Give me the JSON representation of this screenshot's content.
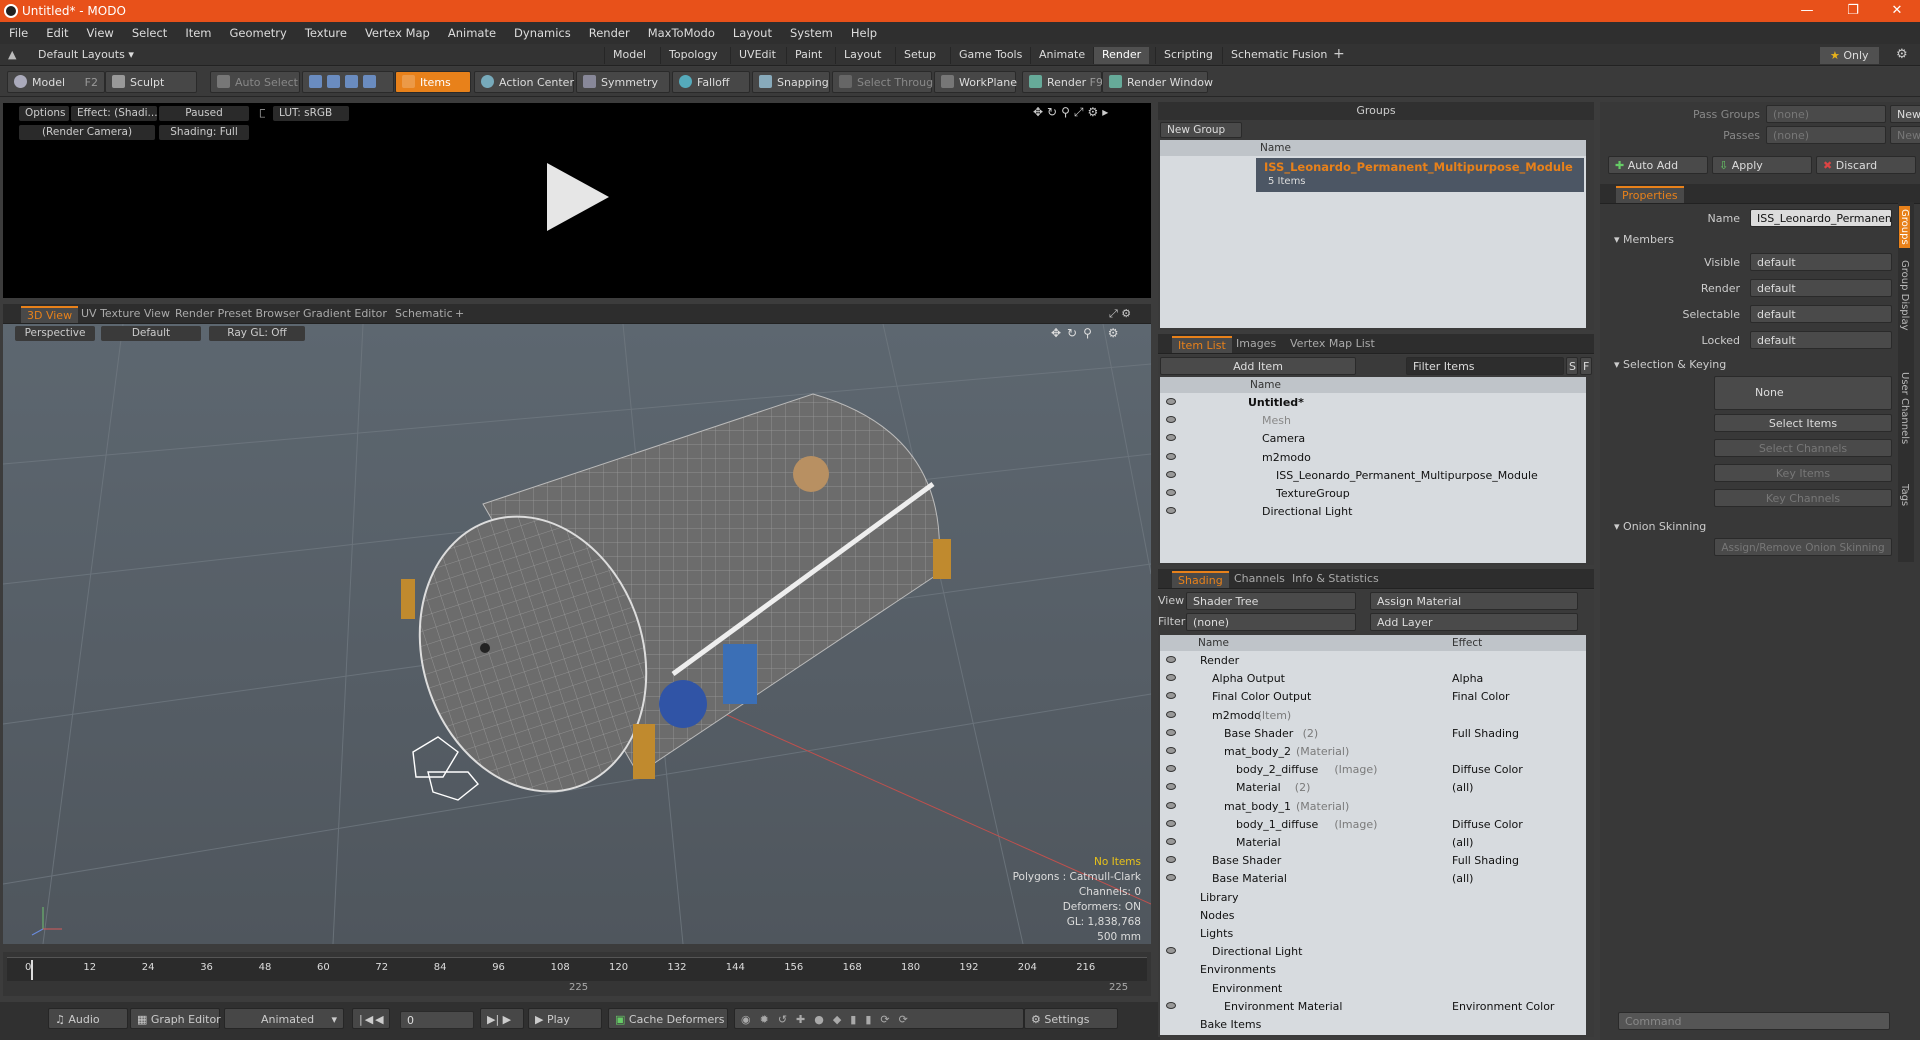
{
  "window": {
    "title": "Untitled* - MODO"
  },
  "menu": [
    "File",
    "Edit",
    "View",
    "Select",
    "Item",
    "Geometry",
    "Texture",
    "Vertex Map",
    "Animate",
    "Dynamics",
    "Render",
    "MaxToModo",
    "Layout",
    "System",
    "Help"
  ],
  "layoutbar": {
    "preset": "Default Layouts",
    "tabs": [
      "Model",
      "Topology",
      "UVEdit",
      "Paint",
      "Layout",
      "Setup",
      "Game Tools",
      "Animate",
      "Render",
      "Scripting",
      "Schematic Fusion"
    ],
    "active": "Render",
    "only": "Only"
  },
  "toolbar": {
    "model": "Model",
    "model_key": "F2",
    "sculpt": "Sculpt",
    "auto_select": "Auto Select",
    "items": "Items",
    "action_center": "Action Center",
    "symmetry": "Symmetry",
    "falloff": "Falloff",
    "snapping": "Snapping",
    "select_through": "Select Through",
    "workplane": "WorkPlane",
    "render": "Render",
    "render_key": "F9",
    "render_window": "Render Window"
  },
  "preview": {
    "options": "Options",
    "effect": "Effect: (Shadi...",
    "paused": "Paused",
    "lut": "LUT: sRGB",
    "camera": "(Render Camera)",
    "shading": "Shading: Full"
  },
  "viewport_tabs": [
    "3D View",
    "UV Texture View",
    "Render Preset Browser",
    "Gradient Editor",
    "Schematic"
  ],
  "viewport": {
    "perspective": "Perspective",
    "default": "Default",
    "raygl": "Ray GL: Off",
    "info": [
      "No Items",
      "Polygons : Catmull-Clark",
      "Channels: 0",
      "Deformers: ON",
      "GL: 1,838,768",
      "500 mm"
    ]
  },
  "timeline": {
    "ticks": [
      "0",
      "12",
      "24",
      "36",
      "48",
      "60",
      "72",
      "84",
      "96",
      "108",
      "120",
      "132",
      "144",
      "156",
      "168",
      "180",
      "192",
      "204",
      "216"
    ],
    "marker": "225",
    "end": "225"
  },
  "playbar": {
    "audio": "Audio",
    "graph_editor": "Graph Editor",
    "animated": "Animated",
    "frame": "0",
    "play": "Play",
    "cache": "Cache Deformers",
    "settings": "Settings"
  },
  "groups": {
    "title": "Groups",
    "new_group": "New Group",
    "col_name": "Name",
    "item": "ISS_Leonardo_Permanent_Multipurpose_Module",
    "count": "5 Items"
  },
  "itemlist": {
    "tabs": [
      "Item List",
      "Images",
      "Vertex Map List"
    ],
    "add_item": "Add Item",
    "filter": "Filter Items",
    "s": "S",
    "f": "F",
    "col_name": "Name",
    "rows": [
      {
        "label": "Untitled*",
        "indent": 0
      },
      {
        "label": "Mesh",
        "indent": 1
      },
      {
        "label": "Camera",
        "indent": 1
      },
      {
        "label": "m2modo",
        "indent": 1
      },
      {
        "label": "ISS_Leonardo_Permanent_Multipurpose_Module",
        "indent": 2
      },
      {
        "label": "TextureGroup",
        "indent": 2
      },
      {
        "label": "Directional Light",
        "indent": 1
      }
    ]
  },
  "shading": {
    "tabs": [
      "Shading",
      "Channels",
      "Info & Statistics"
    ],
    "view_label": "View",
    "view": "Shader Tree",
    "assign": "Assign Material",
    "filter_label": "Filter",
    "filter": "(none)",
    "add_layer": "Add Layer",
    "col_name": "Name",
    "col_effect": "Effect",
    "rows": [
      {
        "name": "Render",
        "sub": "",
        "effect": "",
        "ind": 0
      },
      {
        "name": "Alpha Output",
        "sub": "",
        "effect": "Alpha",
        "ind": 1
      },
      {
        "name": "Final Color Output",
        "sub": "",
        "effect": "Final Color",
        "ind": 1
      },
      {
        "name": "m2modo",
        "sub": "(Item)",
        "effect": "",
        "ind": 1
      },
      {
        "name": "Base Shader",
        "sub": "(2)",
        "effect": "Full Shading",
        "ind": 2
      },
      {
        "name": "mat_body_2",
        "sub": "(Material)",
        "effect": "",
        "ind": 2
      },
      {
        "name": "body_2_diffuse",
        "sub": "(Image)",
        "effect": "Diffuse Color",
        "ind": 3
      },
      {
        "name": "Material",
        "sub": "(2)",
        "effect": "(all)",
        "ind": 3
      },
      {
        "name": "mat_body_1",
        "sub": "(Material)",
        "effect": "",
        "ind": 2
      },
      {
        "name": "body_1_diffuse",
        "sub": "(Image)",
        "effect": "Diffuse Color",
        "ind": 3
      },
      {
        "name": "Material",
        "sub": "",
        "effect": "(all)",
        "ind": 3
      },
      {
        "name": "Base Shader",
        "sub": "",
        "effect": "Full Shading",
        "ind": 1
      },
      {
        "name": "Base Material",
        "sub": "",
        "effect": "(all)",
        "ind": 1
      },
      {
        "name": "Library",
        "sub": "",
        "effect": "",
        "ind": 0
      },
      {
        "name": "Nodes",
        "sub": "",
        "effect": "",
        "ind": 0
      },
      {
        "name": "Lights",
        "sub": "",
        "effect": "",
        "ind": 0
      },
      {
        "name": "Directional Light",
        "sub": "",
        "effect": "",
        "ind": 1
      },
      {
        "name": "Environments",
        "sub": "",
        "effect": "",
        "ind": 0
      },
      {
        "name": "Environment",
        "sub": "",
        "effect": "",
        "ind": 1
      },
      {
        "name": "Environment Material",
        "sub": "",
        "effect": "Environment Color",
        "ind": 2
      },
      {
        "name": "Bake Items",
        "sub": "",
        "effect": "",
        "ind": 0
      }
    ]
  },
  "props": {
    "pass_groups": "Pass Groups",
    "passes": "Passes",
    "none": "(none)",
    "new": "New",
    "auto_add": "Auto Add",
    "apply": "Apply",
    "discard": "Discard",
    "tab": "Properties",
    "name_label": "Name",
    "name_value": "ISS_Leonardo_Permanent_Multipu",
    "members": "Members",
    "visible": "Visible",
    "render": "Render",
    "selectable": "Selectable",
    "locked": "Locked",
    "default": "default",
    "sel_keying": "Selection & Keying",
    "none_btn": "None",
    "select_items": "Select Items",
    "select_channels": "Select Channels",
    "key_items": "Key Items",
    "key_channels": "Key Channels",
    "onion": "Onion Skinning",
    "assign_onion": "Assign/Remove Onion Skinning",
    "side_tabs": [
      "Groups",
      "Group Display",
      "User Channels",
      "Tags"
    ],
    "command": "Command"
  }
}
